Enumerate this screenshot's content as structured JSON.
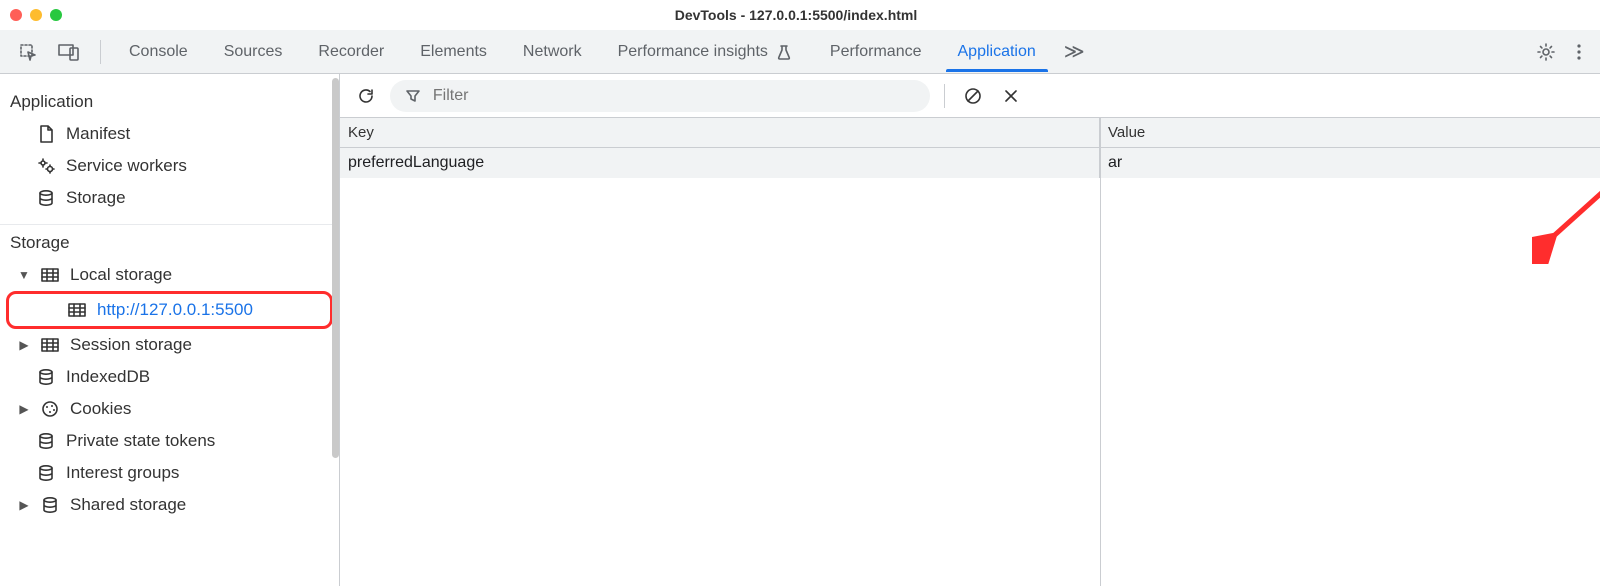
{
  "window": {
    "title": "DevTools - 127.0.0.1:5500/index.html"
  },
  "tabs": {
    "console": "Console",
    "sources": "Sources",
    "recorder": "Recorder",
    "elements": "Elements",
    "network": "Network",
    "perf_insights": "Performance insights",
    "performance": "Performance",
    "application": "Application",
    "active": "application"
  },
  "sidebar": {
    "sections": {
      "application": {
        "title": "Application",
        "items": [
          {
            "label": "Manifest",
            "icon": "file-icon"
          },
          {
            "label": "Service workers",
            "icon": "gears-icon"
          },
          {
            "label": "Storage",
            "icon": "database-icon"
          }
        ]
      },
      "storage": {
        "title": "Storage",
        "items": [
          {
            "label": "Local storage",
            "icon": "table-icon",
            "expanded": true,
            "children": [
              {
                "label": "http://127.0.0.1:5500",
                "icon": "table-icon",
                "selected": true
              }
            ]
          },
          {
            "label": "Session storage",
            "icon": "table-icon",
            "expanded": false
          },
          {
            "label": "IndexedDB",
            "icon": "database-icon"
          },
          {
            "label": "Cookies",
            "icon": "cookie-icon",
            "expanded": false
          },
          {
            "label": "Private state tokens",
            "icon": "database-icon"
          },
          {
            "label": "Interest groups",
            "icon": "database-icon"
          },
          {
            "label": "Shared storage",
            "icon": "database-icon",
            "expanded": false
          }
        ]
      }
    }
  },
  "pane": {
    "filter_placeholder": "Filter",
    "headers": {
      "key": "Key",
      "value": "Value"
    },
    "rows": [
      {
        "key": "preferredLanguage",
        "value": "ar"
      }
    ]
  },
  "annotation": {
    "arrow_color": "#ff2d2d"
  }
}
